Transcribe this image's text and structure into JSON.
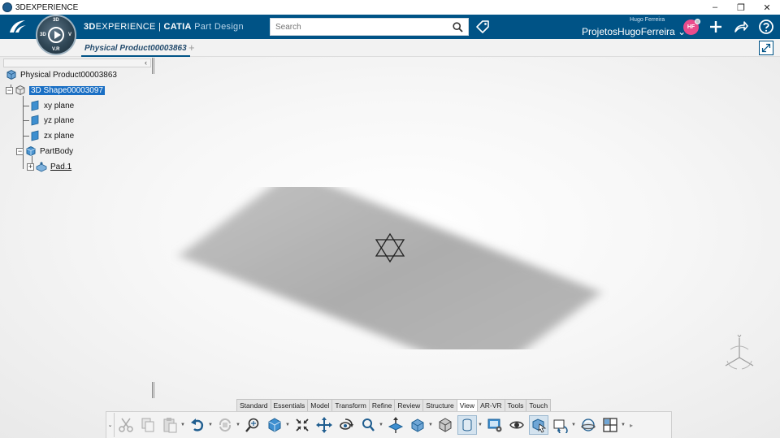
{
  "window": {
    "title": "3DEXPERIENCE",
    "controls": {
      "minimize": "–",
      "restore": "❐",
      "close": "✕"
    }
  },
  "header": {
    "brand_3d": "3D",
    "brand_experience": "EXPERIENCE",
    "brand_sep": " | ",
    "brand_catia": "CATIA",
    "brand_app": " Part Design",
    "compass_labels": {
      "top": "3D",
      "left": "3D",
      "right": "V",
      "bottom": "V.R"
    },
    "search_placeholder": "Search",
    "user_name": "Hugo Ferreira",
    "user_space": "ProjetosHugoFerreira",
    "avatar_initials": "HF",
    "accent_color": "#005386"
  },
  "tabs": {
    "active_label": "Physical Product00003863",
    "add_label": "+"
  },
  "tree": {
    "collapse_label": "‹",
    "nodes": [
      {
        "label": "Physical Product00003863",
        "icon": "physical-product-icon"
      },
      {
        "label": "3D Shape00003097",
        "icon": "3d-shape-icon",
        "expander": "−",
        "selected": true
      },
      {
        "label": "xy plane",
        "icon": "plane-icon"
      },
      {
        "label": "yz plane",
        "icon": "plane-icon"
      },
      {
        "label": "zx plane",
        "icon": "plane-icon"
      },
      {
        "label": "PartBody",
        "icon": "part-body-icon",
        "expander": "−"
      },
      {
        "label": "Pad.1",
        "icon": "pad-icon",
        "expander": "+"
      }
    ]
  },
  "action_bar": {
    "tabs": [
      "Standard",
      "Essentials",
      "Model",
      "Transform",
      "Refine",
      "Review",
      "Structure",
      "View",
      "AR-VR",
      "Tools",
      "Touch"
    ],
    "active_tab": "View",
    "more_label": "▸",
    "collapse_label": "⌄"
  }
}
